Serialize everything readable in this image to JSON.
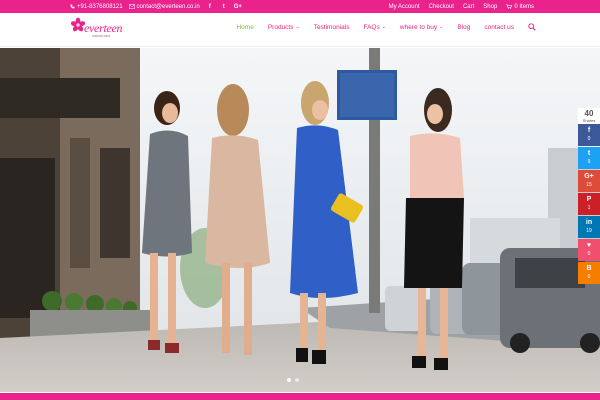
{
  "topbar": {
    "phone": "+91-8376808121",
    "email": "contact@everteen.co.in",
    "social": [
      {
        "icon": "facebook-icon",
        "glyph": "f"
      },
      {
        "icon": "twitter-icon",
        "glyph": "t"
      },
      {
        "icon": "google-plus-icon",
        "glyph": "G+"
      }
    ],
    "links": [
      "My Account",
      "Checkout",
      "Cart",
      "Shop"
    ],
    "cart_items": "0 Items"
  },
  "header": {
    "brand": "everteen",
    "tagline": "natural care",
    "nav": [
      {
        "label": "Home",
        "active": true,
        "dropdown": false
      },
      {
        "label": "Products",
        "active": false,
        "dropdown": true
      },
      {
        "label": "Testimonials",
        "active": false,
        "dropdown": false
      },
      {
        "label": "FAQs",
        "active": false,
        "dropdown": true
      },
      {
        "label": "where to buy",
        "active": false,
        "dropdown": true
      },
      {
        "label": "Blog",
        "active": false,
        "dropdown": false
      },
      {
        "label": "contact us",
        "active": false,
        "dropdown": false
      }
    ]
  },
  "hero": {
    "slides": 2,
    "active_slide": 1
  },
  "share": {
    "total": "40",
    "total_label": "Shares",
    "buttons": [
      {
        "network": "facebook",
        "icon": "facebook-icon",
        "glyph": "f",
        "count": "0",
        "color": "#3b5998"
      },
      {
        "network": "twitter",
        "icon": "twitter-icon",
        "glyph": "t",
        "count": "9",
        "color": "#1da1f2"
      },
      {
        "network": "google-plus",
        "icon": "google-plus-icon",
        "glyph": "G+",
        "count": "15",
        "color": "#dd4b39"
      },
      {
        "network": "pinterest",
        "icon": "pinterest-icon",
        "glyph": "P",
        "count": "1",
        "color": "#cb2027"
      },
      {
        "network": "linkedin",
        "icon": "linkedin-icon",
        "glyph": "in",
        "count": "19",
        "color": "#0077b5"
      },
      {
        "network": "love",
        "icon": "heart-icon",
        "glyph": "♥",
        "count": "0",
        "color": "#f0506e"
      },
      {
        "network": "blogger",
        "icon": "blogger-icon",
        "glyph": "B",
        "count": "0",
        "color": "#f57d00"
      }
    ]
  },
  "colors": {
    "brand_pink": "#e9238b",
    "active_green": "#7cbf3a"
  }
}
